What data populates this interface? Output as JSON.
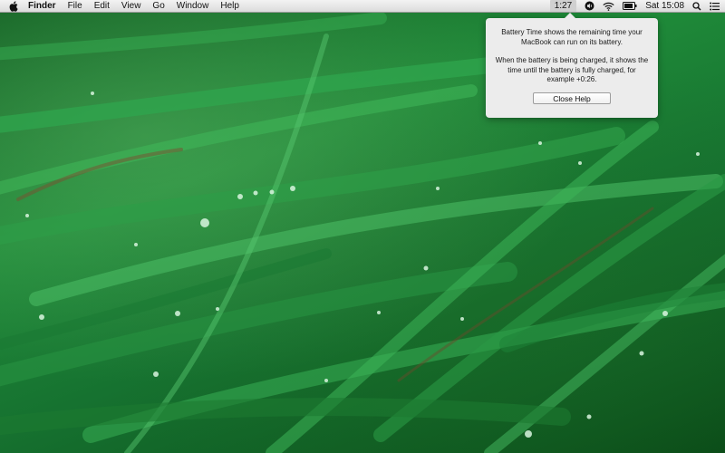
{
  "menubar": {
    "apple_icon": "apple-icon",
    "app_name": "Finder",
    "menus": [
      "File",
      "Edit",
      "View",
      "Go",
      "Window",
      "Help"
    ],
    "status": {
      "battery_time": "1:27",
      "icons": [
        "volume-icon",
        "wifi-icon",
        "battery-icon",
        "spotlight-icon",
        "notification-center-icon"
      ],
      "clock": "Sat 15:08"
    }
  },
  "help_popover": {
    "paragraph_1": "Battery Time shows the remaining time your MacBook can run on its battery.",
    "paragraph_2": "When the battery is being charged, it shows the time until the battery is fully charged, for example +0:26.",
    "close_label": "Close Help"
  },
  "colors": {
    "wallpaper_base": "#1f8a39",
    "menubar_bg": "#e9e9e9",
    "popover_bg": "#ececec"
  }
}
